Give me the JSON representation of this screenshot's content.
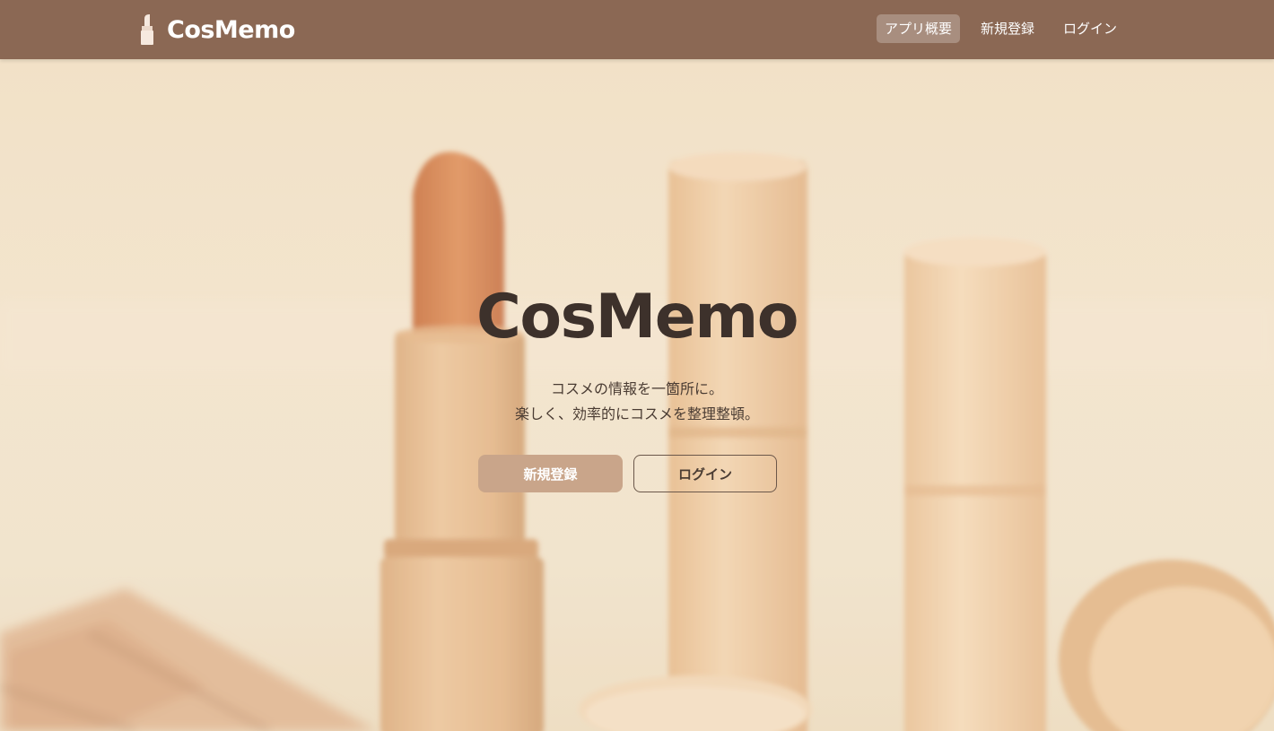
{
  "brand": {
    "name": "CosMemo",
    "icon": "lipstick-icon"
  },
  "nav": {
    "items": [
      {
        "label": "アプリ概要",
        "active": true
      },
      {
        "label": "新規登録",
        "active": false
      },
      {
        "label": "ログイン",
        "active": false
      }
    ]
  },
  "hero": {
    "title": "CosMemo",
    "tagline_line1": "コスメの情報を一箇所に。",
    "tagline_line2": "楽しく、効率的にコスメを整理整頓。",
    "primary_button": "新規登録",
    "secondary_button": "ログイン"
  },
  "colors": {
    "navbar": "#8b6854",
    "primary_button": "#c9a58a",
    "text_dark": "#3d312b",
    "background": "#efe0c4"
  }
}
